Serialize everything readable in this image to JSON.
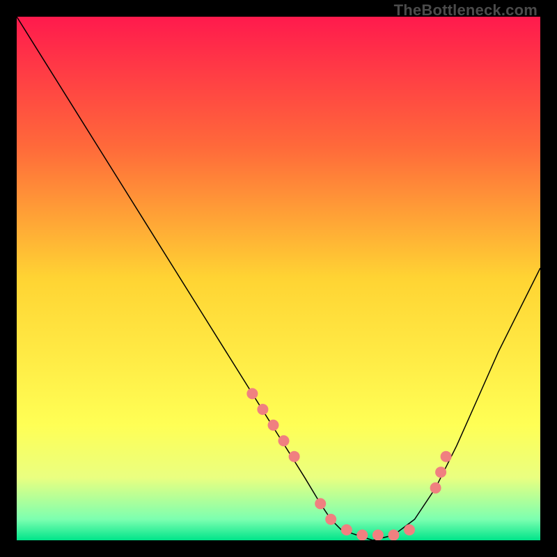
{
  "watermark": "TheBottleneck.com",
  "chart_data": {
    "type": "line",
    "title": "",
    "xlabel": "",
    "ylabel": "",
    "xlim": [
      0,
      100
    ],
    "ylim": [
      0,
      100
    ],
    "grid": false,
    "legend": false,
    "background_gradient": {
      "orientation": "vertical",
      "stops": [
        {
          "pos": 0.0,
          "color": "#ff1a4d"
        },
        {
          "pos": 0.25,
          "color": "#ff6a3a"
        },
        {
          "pos": 0.5,
          "color": "#ffd433"
        },
        {
          "pos": 0.78,
          "color": "#ffff55"
        },
        {
          "pos": 0.88,
          "color": "#eaff80"
        },
        {
          "pos": 0.96,
          "color": "#7cffb0"
        },
        {
          "pos": 1.0,
          "color": "#00e48a"
        }
      ]
    },
    "series": [
      {
        "name": "bottleneck-curve",
        "color": "#000000",
        "stroke_width": 1.5,
        "x": [
          0,
          5,
          10,
          15,
          20,
          25,
          30,
          35,
          40,
          45,
          50,
          55,
          58,
          60,
          62,
          65,
          68,
          72,
          76,
          80,
          84,
          88,
          92,
          96,
          100
        ],
        "y": [
          100,
          92,
          84,
          76,
          68,
          60,
          52,
          44,
          36,
          28,
          20,
          12,
          7,
          4,
          2,
          1,
          0,
          1,
          4,
          10,
          18,
          27,
          36,
          44,
          52
        ]
      },
      {
        "name": "highlight-dots",
        "type": "scatter",
        "color": "#f08080",
        "marker_radius": 8,
        "x": [
          45,
          47,
          49,
          51,
          53,
          58,
          60,
          63,
          66,
          69,
          72,
          75,
          80,
          81,
          82
        ],
        "y": [
          28,
          25,
          22,
          19,
          16,
          7,
          4,
          2,
          1,
          1,
          1,
          2,
          10,
          13,
          16
        ]
      }
    ],
    "annotations": []
  }
}
